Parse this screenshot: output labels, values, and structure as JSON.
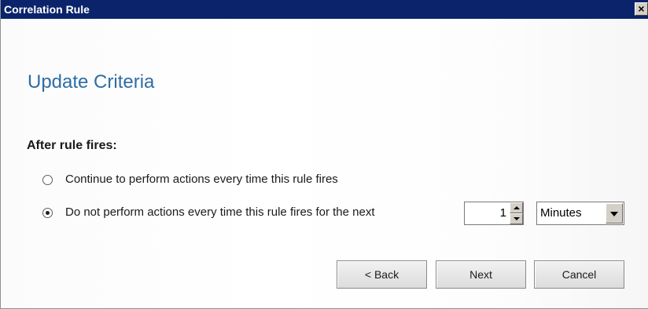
{
  "window": {
    "title": "Correlation Rule",
    "close_label": "×"
  },
  "page": {
    "heading": "Update Criteria",
    "section_label": "After rule fires:"
  },
  "options": [
    {
      "label": "Continue to perform actions every time this rule fires",
      "selected": false
    },
    {
      "label": "Do not perform actions every time this rule fires for the next",
      "selected": true
    }
  ],
  "interval": {
    "value": "1",
    "unit": "Minutes"
  },
  "buttons": {
    "back": "< Back",
    "next": "Next",
    "cancel": "Cancel"
  },
  "colors": {
    "titlebar": "#0a236b",
    "heading": "#2e6da4"
  }
}
